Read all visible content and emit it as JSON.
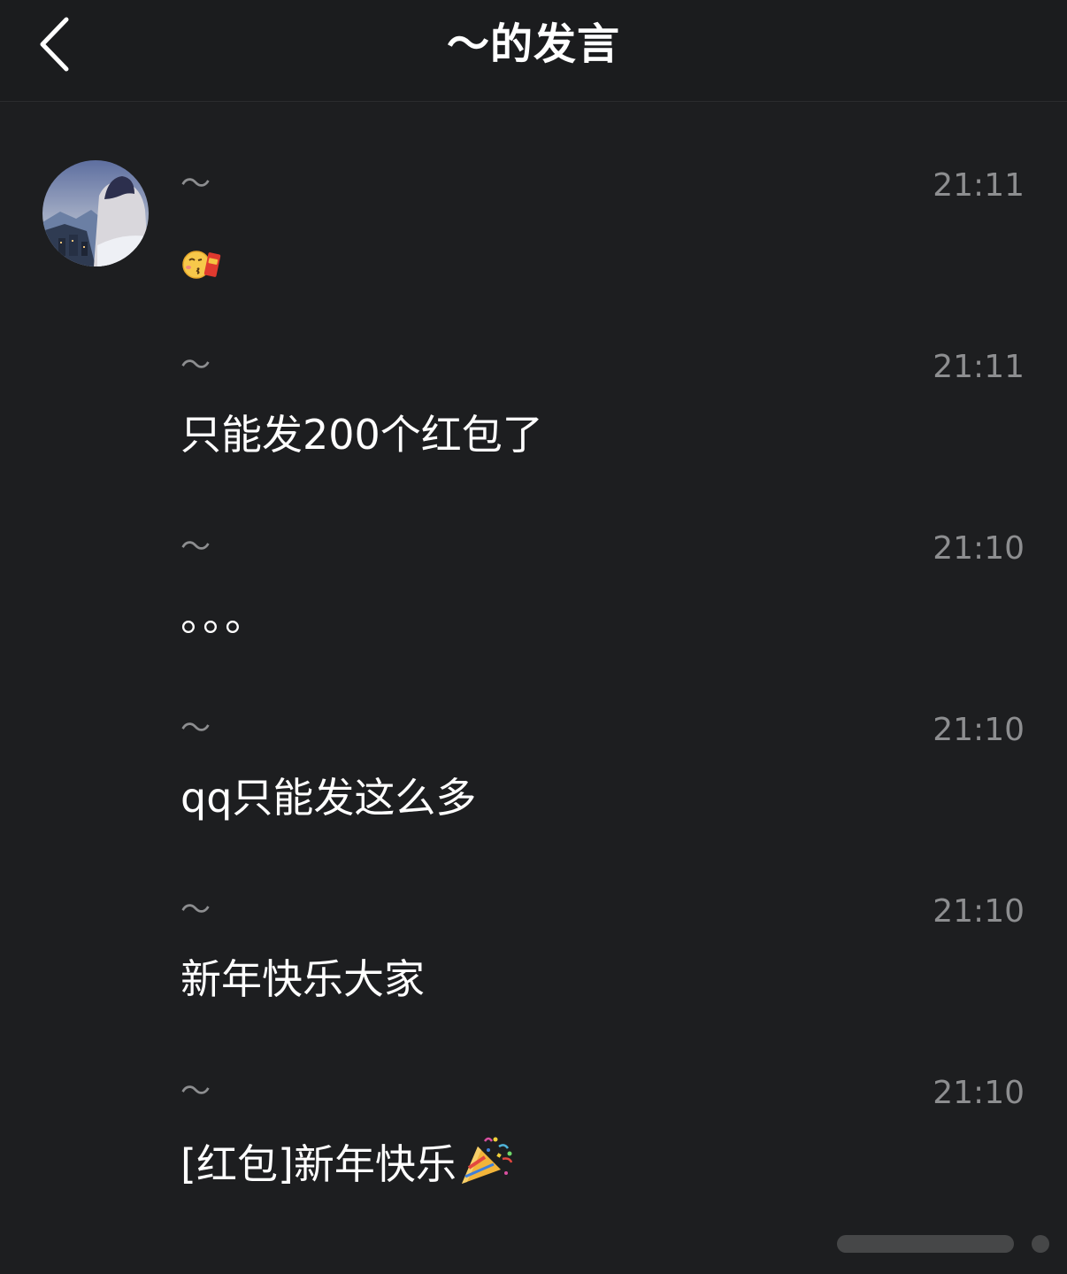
{
  "header": {
    "title": "～的发言"
  },
  "messages": [
    {
      "name": "～",
      "time": "21:11",
      "text": "",
      "emoji": "kissing-face-with-red-envelope"
    },
    {
      "name": "～",
      "time": "21:11",
      "text": "只能发200个红包了"
    },
    {
      "name": "～",
      "time": "21:10",
      "text": "。。。"
    },
    {
      "name": "～",
      "time": "21:10",
      "text": "qq只能发这么多"
    },
    {
      "name": "～",
      "time": "21:10",
      "text": "新年快乐大家"
    },
    {
      "name": "～",
      "time": "21:10",
      "text": "[红包]新年快乐",
      "emoji": "party-popper"
    }
  ],
  "colors": {
    "background": "#1d1e20",
    "header": "#1b1c1e",
    "meta_text": "#8d8e90",
    "message_text": "#ffffff"
  }
}
